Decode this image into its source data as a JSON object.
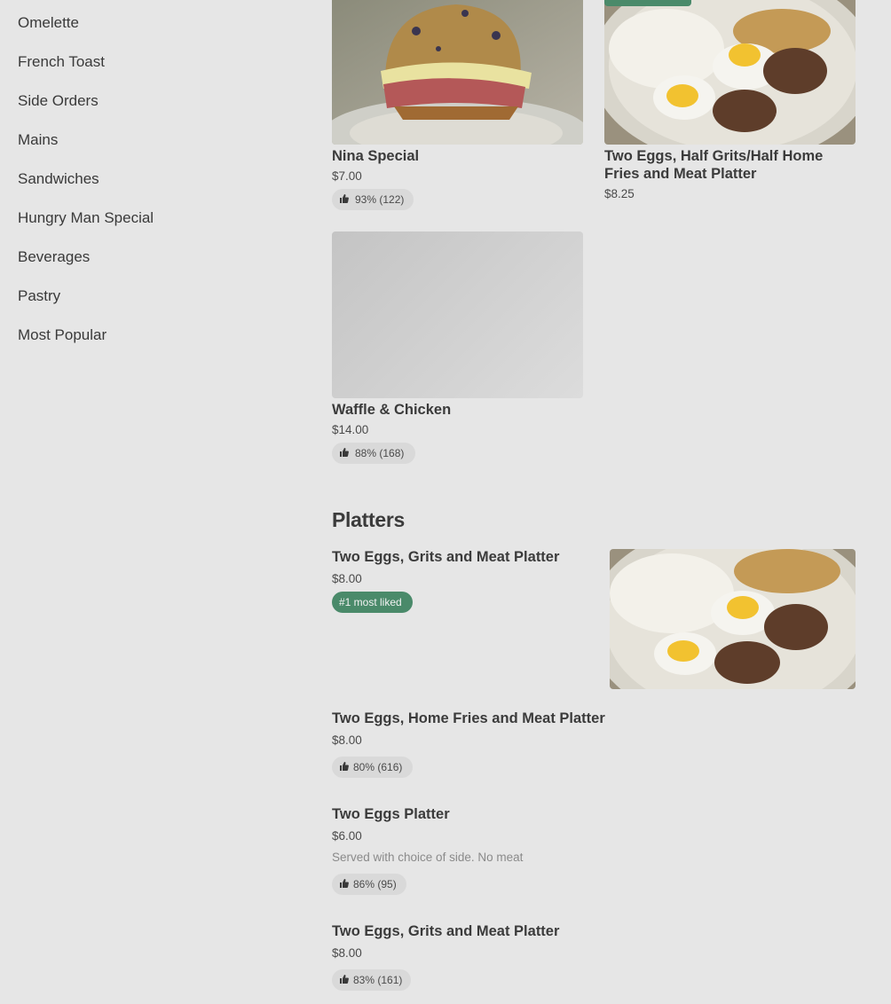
{
  "sidebar": {
    "items": [
      {
        "label": "Omelette"
      },
      {
        "label": "French Toast"
      },
      {
        "label": "Side Orders"
      },
      {
        "label": "Mains"
      },
      {
        "label": "Sandwiches"
      },
      {
        "label": "Hungry Man Special"
      },
      {
        "label": "Beverages"
      },
      {
        "label": "Pastry"
      },
      {
        "label": "Most Popular"
      }
    ]
  },
  "grid_items": [
    {
      "title": "Nina Special",
      "price": "$7.00",
      "rating": "93% (122)"
    },
    {
      "title": "Two Eggs, Half Grits/Half Home Fries and Meat Platter",
      "price": "$8.25"
    },
    {
      "title": "Waffle & Chicken",
      "price": "$14.00",
      "rating": "88% (168)"
    }
  ],
  "platters": {
    "section_title": "Platters",
    "items": [
      {
        "title": "Two Eggs, Grits and Meat Platter",
        "price": "$8.00",
        "badge": "#1 most liked"
      },
      {
        "title": "Two Eggs, Home Fries and Meat Platter",
        "price": "$8.00",
        "rating": "80% (616)"
      },
      {
        "title": "Two Eggs Platter",
        "price": "$6.00",
        "description": "Served with choice of side. No meat",
        "rating": "86% (95)"
      },
      {
        "title": "Two Eggs, Grits and Meat Platter",
        "price": "$8.00",
        "rating": "83% (161)"
      }
    ]
  },
  "icons": {
    "rating": "thumbs-up-icon"
  },
  "colors": {
    "accent_green": "#4a8a6a",
    "background": "#e6e6e6",
    "pill": "#d9d9d9"
  }
}
